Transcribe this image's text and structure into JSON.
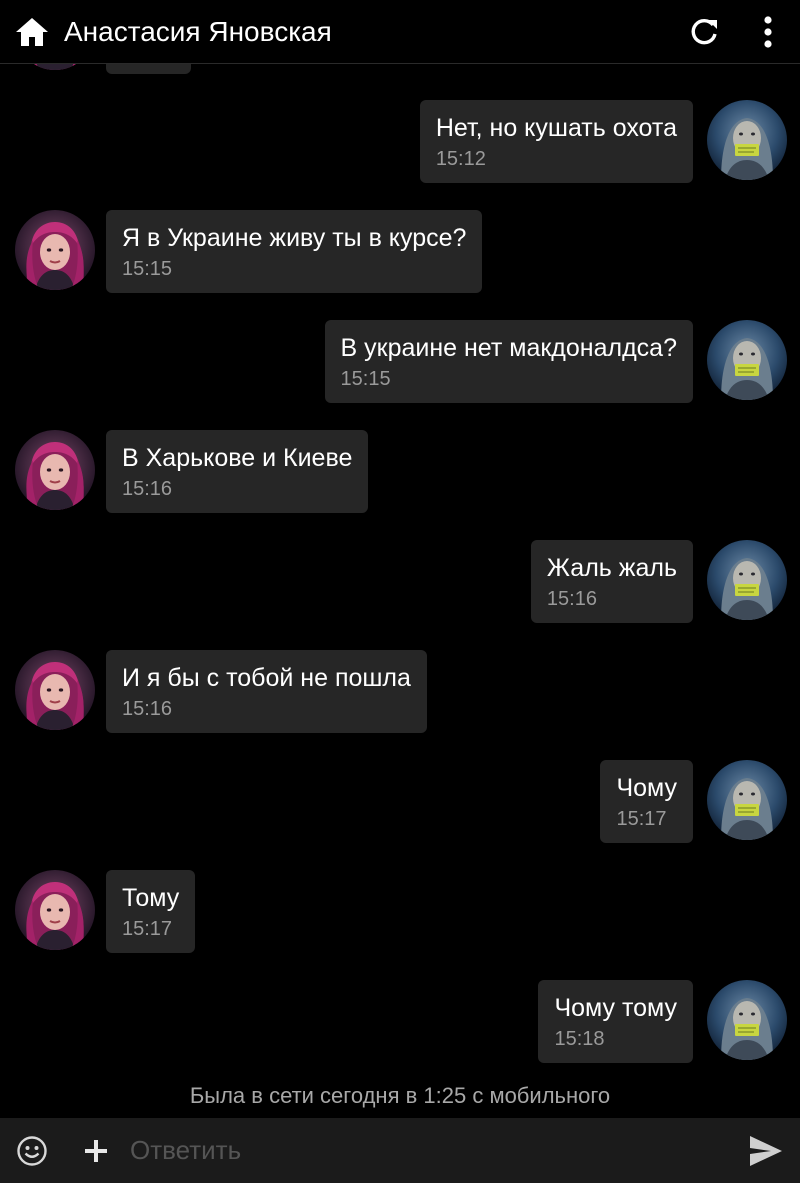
{
  "header": {
    "title": "Анастасия Яновская",
    "home_icon": "home-icon",
    "refresh_icon": "refresh-icon",
    "menu_icon": "more-vert-icon"
  },
  "messages": [
    {
      "side": "them",
      "text": "",
      "time": ""
    },
    {
      "side": "me",
      "text": "Нет, но кушать охота",
      "time": "15:12"
    },
    {
      "side": "them",
      "text": "Я в Украине живу ты в курсе?",
      "time": "15:15"
    },
    {
      "side": "me",
      "text": "В украине нет макдоналдса?",
      "time": "15:15"
    },
    {
      "side": "them",
      "text": "В Харькове и Киеве",
      "time": "15:16"
    },
    {
      "side": "me",
      "text": "Жаль жаль",
      "time": "15:16"
    },
    {
      "side": "them",
      "text": "И я бы с тобой не пошла",
      "time": "15:16"
    },
    {
      "side": "me",
      "text": "Чому",
      "time": "15:17"
    },
    {
      "side": "them",
      "text": "Тому",
      "time": "15:17"
    },
    {
      "side": "me",
      "text": "Чому тому",
      "time": "15:18"
    }
  ],
  "status_text": "Была в сети сегодня в 1:25 с мобильного",
  "composer": {
    "placeholder": "Ответить",
    "emoji_icon": "emoji-icon",
    "attach_icon": "plus-icon",
    "send_icon": "send-icon"
  },
  "colors": {
    "background": "#000000",
    "bubble": "#262626",
    "time_text": "#9a9a9a",
    "composer_bg": "#1b1b1b"
  }
}
